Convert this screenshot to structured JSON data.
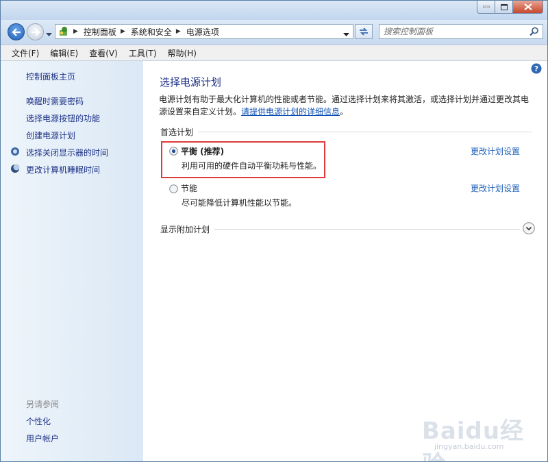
{
  "address": {
    "crumbs": [
      "控制面板",
      "系统和安全",
      "电源选项"
    ]
  },
  "search": {
    "placeholder": "搜索控制面板"
  },
  "menu": [
    "文件(F)",
    "编辑(E)",
    "查看(V)",
    "工具(T)",
    "帮助(H)"
  ],
  "sidebar": {
    "home": "控制面板主页",
    "links": [
      "唤醒时需要密码",
      "选择电源按钮的功能",
      "创建电源计划",
      "选择关闭显示器的时间",
      "更改计算机睡眠时间"
    ],
    "see_also_caption": "另请参阅",
    "see_also": [
      "个性化",
      "用户帐户"
    ]
  },
  "main": {
    "title": "选择电源计划",
    "desc_text": "电源计划有助于最大化计算机的性能或者节能。通过选择计划来将其激活，或选择计划并通过更改其电源设置来自定义计划。",
    "desc_link": "请提供电源计划的详细信息",
    "desc_end": "。",
    "preferred_header": "首选计划",
    "plans": [
      {
        "name": "平衡 (推荐)",
        "desc": "利用可用的硬件自动平衡功耗与性能。",
        "link": "更改计划设置",
        "selected": true
      },
      {
        "name": "节能",
        "desc": "尽可能降低计算机性能以节能。",
        "link": "更改计划设置",
        "selected": false
      }
    ],
    "additional_header": "显示附加计划"
  },
  "watermark": {
    "text": "Baidu经验",
    "sub": "jingyan.baidu.com"
  },
  "colors": {
    "link": "#1e3287",
    "highlight": "#e0393a",
    "accent_link": "#1e5fb8"
  }
}
